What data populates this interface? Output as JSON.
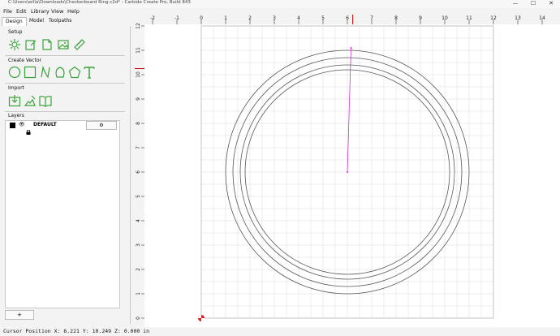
{
  "window": {
    "title": "C:\\Users\\willa\\Downloads\\Checkerboard Ring.c2d* - Carbide Create Pro, Build 843",
    "controls": [
      "—",
      "☐",
      "✕"
    ]
  },
  "menu": [
    "File",
    "Edit",
    "Library",
    "View",
    "Help"
  ],
  "tabs": [
    "Design",
    "Model",
    "Toolpaths"
  ],
  "sections": {
    "setup": "Setup",
    "create_vector": "Create Vector",
    "import": "Import",
    "layers": "Layers"
  },
  "tool_icons": {
    "setup": [
      "gear-icon",
      "edit-document-icon",
      "new-document-icon",
      "image-icon",
      "ruler-icon"
    ],
    "create_vector": [
      "circle-icon",
      "rectangle-icon",
      "curve-icon",
      "polygon-icon",
      "pentagon-icon",
      "text-icon"
    ],
    "import": [
      "import-icon",
      "import-vectors-icon",
      "library-icon"
    ]
  },
  "layers": [
    {
      "name": "DEFAULT",
      "color": "#000000",
      "visible": true,
      "locked": true
    }
  ],
  "add_layer_label": "+",
  "ruler": {
    "x_ticks": [
      "-2",
      "-1",
      "0",
      "1",
      "2",
      "3",
      "4",
      "5",
      "6",
      "7",
      "8",
      "9",
      "10",
      "11",
      "12",
      "13",
      "14"
    ],
    "y_ticks": [
      "12",
      "11",
      "10",
      "9",
      "8",
      "7",
      "6",
      "5",
      "4",
      "3",
      "2",
      "1",
      "0"
    ],
    "cursor_x": 6.221,
    "cursor_y": 10.249
  },
  "drawing": {
    "circle_center_x": 6.0,
    "circle_center_y": 6.0,
    "circle_radii": [
      5.0,
      4.7,
      4.4,
      4.2
    ],
    "line": {
      "x1": 6.0,
      "y1": 6.0,
      "x2": 6.15,
      "y2": 11.1
    }
  },
  "colors": {
    "accent": "#3ca33c",
    "line": "#cc33cc",
    "cursor": "#cc0000",
    "grid": "#d9d9d9",
    "circle": "#555555"
  },
  "status": {
    "text": "Cursor Position X: 6.221 Y: 10.249 Z: 0.000 in"
  }
}
